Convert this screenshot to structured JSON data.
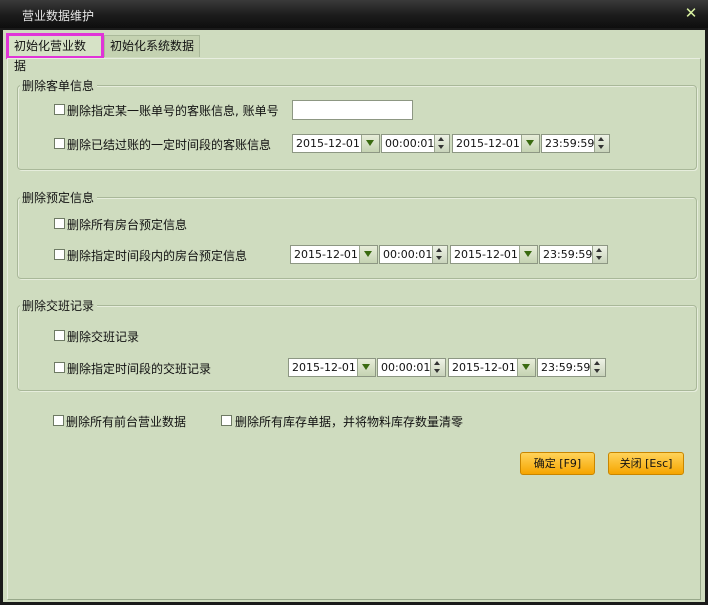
{
  "window": {
    "title": "营业数据维护",
    "close_glyph": "✕"
  },
  "tabs": [
    {
      "label": "初始化营业数据",
      "active": true
    },
    {
      "label": "初始化系统数据",
      "active": false
    }
  ],
  "group_guest": {
    "title": "删除客单信息",
    "opt_account_label": "删除指定某一账单号的客账信息, 账单号",
    "opt_account_value": "",
    "opt_period_label": "删除已结过账的一定时间段的客账信息",
    "start_date": "2015-12-01",
    "start_time": "00:00:01",
    "end_date": "2015-12-01",
    "end_time": "23:59:59"
  },
  "group_booking": {
    "title": "删除预定信息",
    "opt_all_label": "删除所有房台预定信息",
    "opt_period_label": "删除指定时间段内的房台预定信息",
    "start_date": "2015-12-01",
    "start_time": "00:00:01",
    "end_date": "2015-12-01",
    "end_time": "23:59:59"
  },
  "group_shift": {
    "title": "删除交班记录",
    "opt_all_label": "删除交班记录",
    "opt_period_label": "删除指定时间段的交班记录",
    "start_date": "2015-12-01",
    "start_time": "00:00:01",
    "end_date": "2015-12-01",
    "end_time": "23:59:59"
  },
  "extra": {
    "opt_front_label": "删除所有前台营业数据",
    "opt_stock_label": "删除所有库存单据，并将物料库存数量清零"
  },
  "buttons": {
    "confirm": "确定 [F9]",
    "close": "关闭 [Esc]"
  },
  "colors": {
    "panel_bg": "#cfdcbf",
    "accent_button": "#f6a500",
    "active_tab_border": "#e034d8",
    "titlebar": "#1b1b1b"
  }
}
